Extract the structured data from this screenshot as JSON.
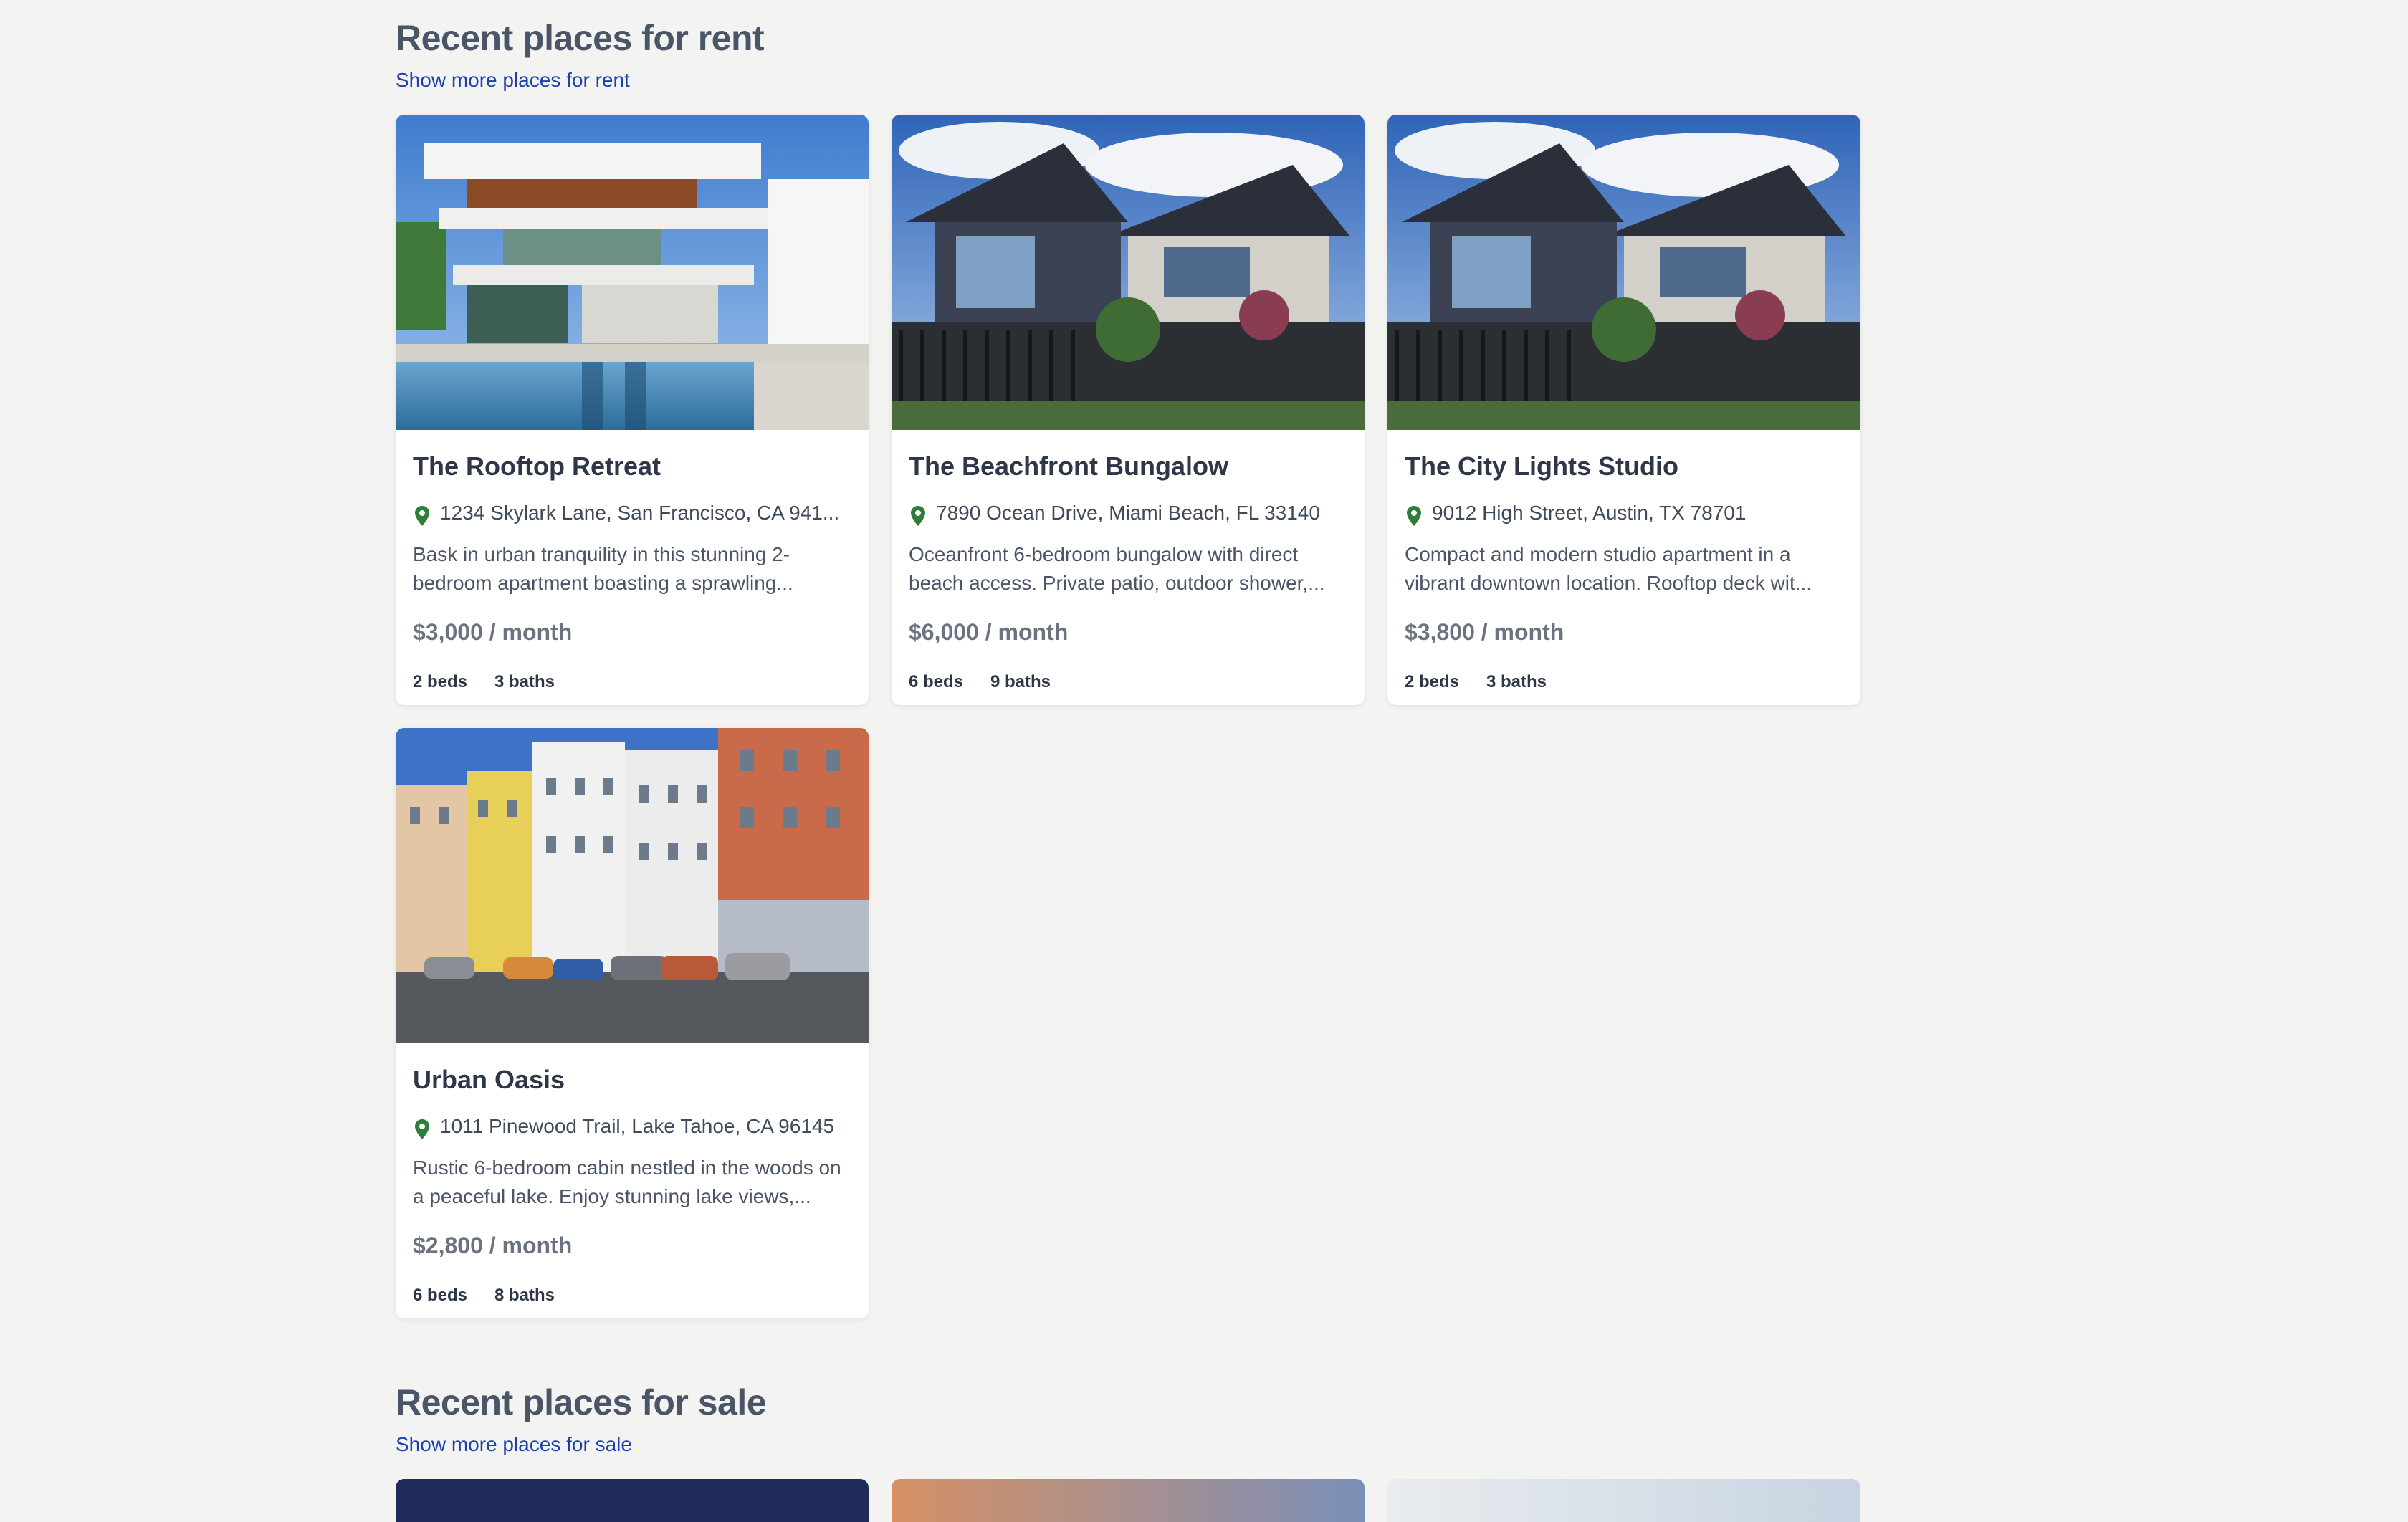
{
  "rent_section": {
    "title": "Recent places for rent",
    "link": "Show more places for rent",
    "listings": [
      {
        "title": "The Rooftop Retreat",
        "address": "1234 Skylark Lane, San Francisco, CA 941...",
        "description": "Bask in urban tranquility in this stunning 2-bedroom apartment boasting a sprawling...",
        "price": "$3,000 / month",
        "beds": "2 beds",
        "baths": "3 baths"
      },
      {
        "title": "The Beachfront Bungalow",
        "address": "7890 Ocean Drive, Miami Beach, FL 33140",
        "description": "Oceanfront 6-bedroom bungalow with direct beach access. Private patio, outdoor shower,...",
        "price": "$6,000 / month",
        "beds": "6 beds",
        "baths": "9 baths"
      },
      {
        "title": "The City Lights Studio",
        "address": "9012 High Street, Austin, TX 78701",
        "description": "Compact and modern studio apartment in a vibrant downtown location. Rooftop deck wit...",
        "price": "$3,800 / month",
        "beds": "2 beds",
        "baths": "3 baths"
      },
      {
        "title": "Urban Oasis",
        "address": "1011 Pinewood Trail, Lake Tahoe, CA 96145",
        "description": "Rustic 6-bedroom cabin nestled in the woods on a peaceful lake. Enjoy stunning lake views,...",
        "price": "$2,800 / month",
        "beds": "6 beds",
        "baths": "8 baths"
      }
    ]
  },
  "sale_section": {
    "title": "Recent places for sale",
    "link": "Show more places for sale"
  },
  "icons": {
    "location": "map-pin-icon"
  },
  "colors": {
    "link": "#1e40af",
    "pin": "#2f7d3a",
    "background": "#f3f4f2"
  }
}
